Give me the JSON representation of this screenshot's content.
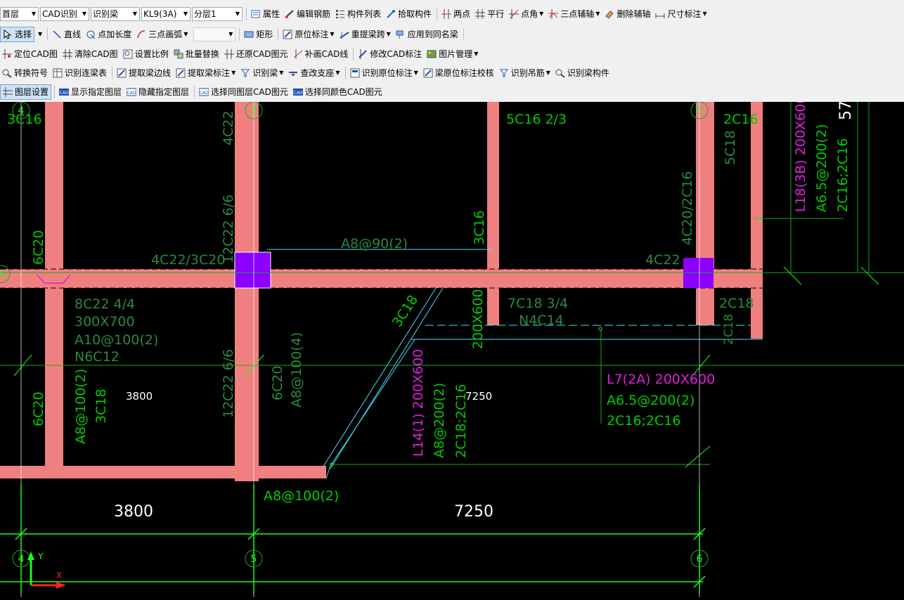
{
  "toolbar": {
    "row1": {
      "floor_select": "首层",
      "mode_select": "CAD识别",
      "type_select": "识别梁",
      "beam_select": "KL9(3A)",
      "layer_select": "分层1",
      "buttons": [
        "属性",
        "编辑钢筋",
        "构件列表",
        "拾取构件",
        "两点",
        "平行",
        "点角",
        "三点辅轴",
        "删除辅轴",
        "尺寸标注"
      ]
    },
    "row2": {
      "select_label": "选择",
      "buttons": [
        "直线",
        "点加长度",
        "三点画弧"
      ],
      "shape_buttons": [
        "矩形",
        "原位标注",
        "重提梁跨",
        "应用到同名梁"
      ]
    },
    "row3": {
      "buttons": [
        "定位CAD图",
        "清除CAD图",
        "设置比例",
        "批量替换",
        "还原CAD图元",
        "补画CAD线",
        "修改CAD标注",
        "图片管理"
      ]
    },
    "row4": {
      "buttons": [
        "转换符号",
        "识别连梁表",
        "提取梁边线",
        "提取梁标注",
        "识别梁",
        "查改支座",
        "识别原位标注",
        "梁原位标注校核",
        "识别吊筋",
        "识别梁构件"
      ]
    },
    "row5": {
      "buttons": [
        "图层设置",
        "显示指定图层",
        "隐藏指定图层",
        "选择同图层CAD图元",
        "选择同颜色CAD图元"
      ]
    }
  },
  "colors": {
    "beam_fill": "#f08080",
    "column_fill": "#8b00ff",
    "label_green": "#00cc00",
    "label_dark_green": "#2a8a40",
    "label_magenta": "#e020e0",
    "axis_green": "#1aff1a",
    "cyan_line": "#40e0ff"
  },
  "drawing": {
    "grid_labels": [
      "4",
      "5",
      "6",
      "A"
    ],
    "dims": {
      "span_3800": "3800",
      "span_7250": "7250"
    },
    "annotations": {
      "a_3c16": "3C16",
      "a_4c22_top": "4C22",
      "a_12c22_66_top": "12C22 6/6",
      "a_5c16": "5C16 2/3",
      "a_2c16_tr": "2C16",
      "a_5c18": "5C18",
      "a_4c20": "4C20/2C16",
      "a_l18": "L18(3B) 200X600",
      "a_l18_stirrup": "A6.5@200(2)",
      "a_l18_bars": "2C16;2C16",
      "a_57": "57",
      "a_6c20_left": "6C20",
      "a_4c22_3c20": "4C22/3C20",
      "a_a8_90": "A8@90(2)",
      "a_3c16_mid": "3C16",
      "a_4c22_right": "4C22",
      "a_8c22": "8C22 4/4",
      "a_300x700": "300X700",
      "a_a10": "A10@100(2)",
      "a_n6c12": "N6C12",
      "a_3c18_diag": "3C18",
      "a_200x600": "200X600",
      "a_7c18": "7C18 3/4",
      "a_n4c14": "N4C14",
      "a_2c18_r": "2C18",
      "a_2c18_r2": "2C18",
      "a_12c22_66": "12C22 6/6",
      "a_6c20_col": "6C20",
      "a_a8_100_4": "A8@100(4)",
      "a_a8_100_left": "A8@100(2)",
      "a_3c18_left": "3C18",
      "a_6c20_lower": "6C20",
      "a_3800_inner": "3800",
      "a_7250_inner": "7250",
      "a_l14": "L14(1) 200X600",
      "a_l14_stirrup": "A8@200(2)",
      "a_l14_bars": "2C18;2C16",
      "a_l7": "L7(2A) 200X600",
      "a_l7_stirrup": "A6.5@200(2)",
      "a_l7_bars": "2C16;2C16",
      "a_a8_100_bottom": "A8@100(2)",
      "ucs_y": "Y",
      "ucs_x": "X"
    }
  }
}
